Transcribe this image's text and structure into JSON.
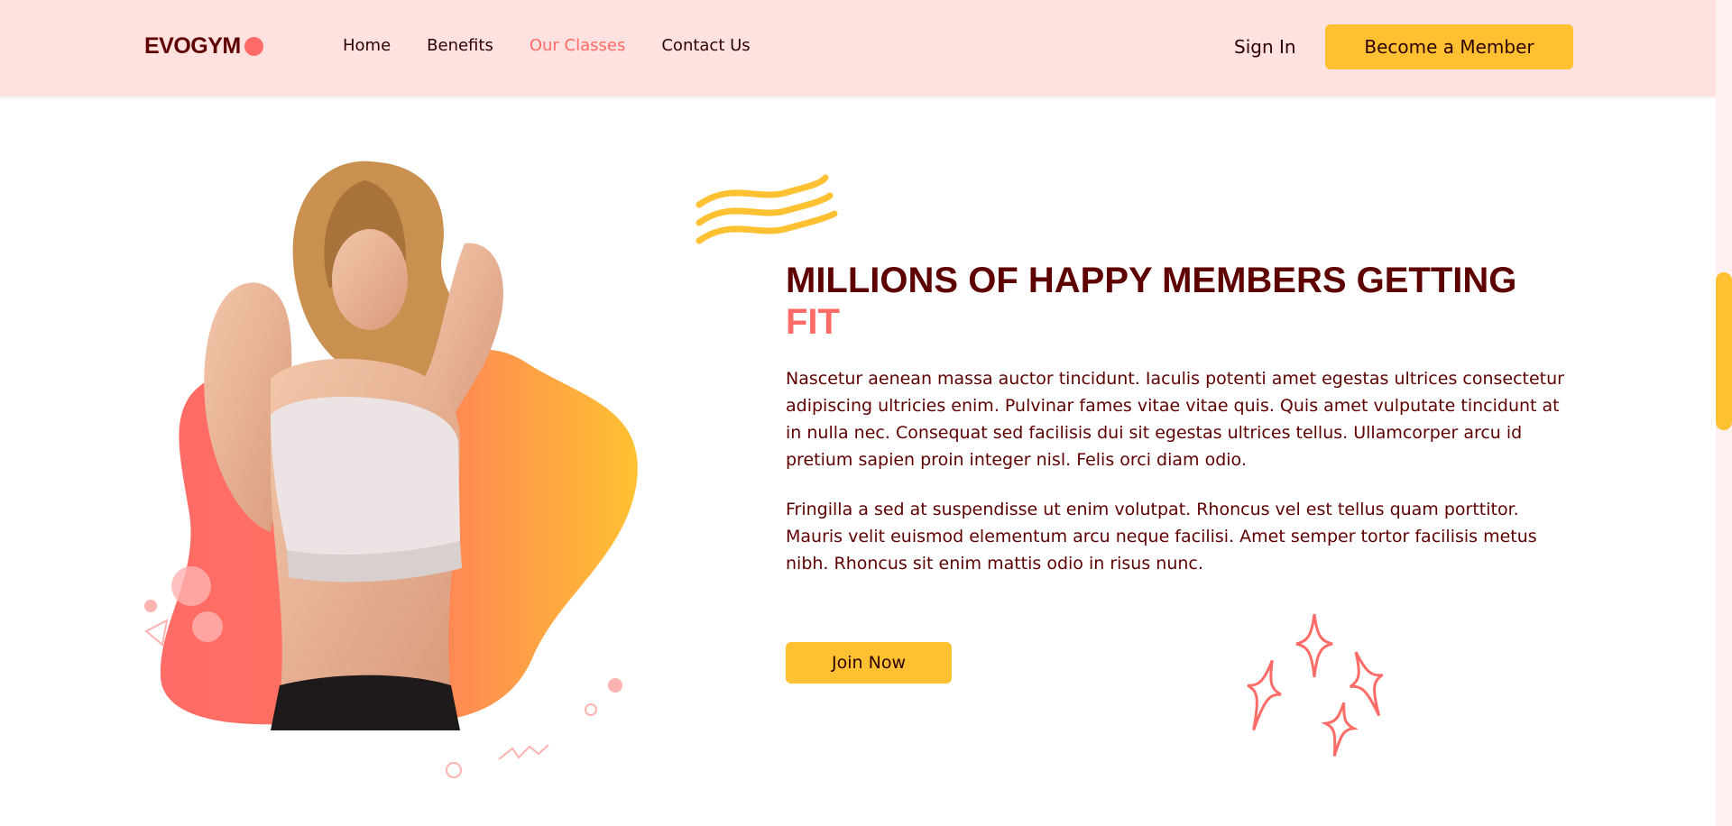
{
  "brand": {
    "logo_text": "EVOGYM"
  },
  "nav": {
    "links": [
      {
        "label": "Home",
        "active": false
      },
      {
        "label": "Benefits",
        "active": false
      },
      {
        "label": "Our Classes",
        "active": true
      },
      {
        "label": "Contact Us",
        "active": false
      }
    ],
    "sign_in": "Sign In",
    "cta": "Become a Member"
  },
  "hero": {
    "headline_main": "MILLIONS OF HAPPY MEMBERS GETTING",
    "headline_accent": "FIT",
    "paragraphs": [
      "Nascetur aenean massa auctor tincidunt. Iaculis potenti amet egestas ultrices consectetur adipiscing ultricies enim. Pulvinar fames vitae vitae quis. Quis amet vulputate tincidunt at in nulla nec. Consequat sed facilisis dui sit egestas ultrices tellus. Ullamcorper arcu id pretium sapien proin integer nisl. Felis orci diam odio.",
      "Fringilla a sed at suspendisse ut enim volutpat. Rhoncus vel est tellus quam porttitor. Mauris velit euismod elementum arcu neque facilisi. Amet semper tortor facilisis metus nibh. Rhoncus sit enim mattis odio in risus nunc."
    ],
    "join_button": "Join Now"
  },
  "colors": {
    "primary_bg": "#ffe1e0",
    "accent_red": "#ff6b66",
    "accent_yellow": "#ffc132",
    "text_dark": "#5e0000"
  },
  "icons": {
    "wave": "wave-lines-icon",
    "sparkles": "sparkle-stars-icon",
    "logo_dot": "circle-icon"
  }
}
